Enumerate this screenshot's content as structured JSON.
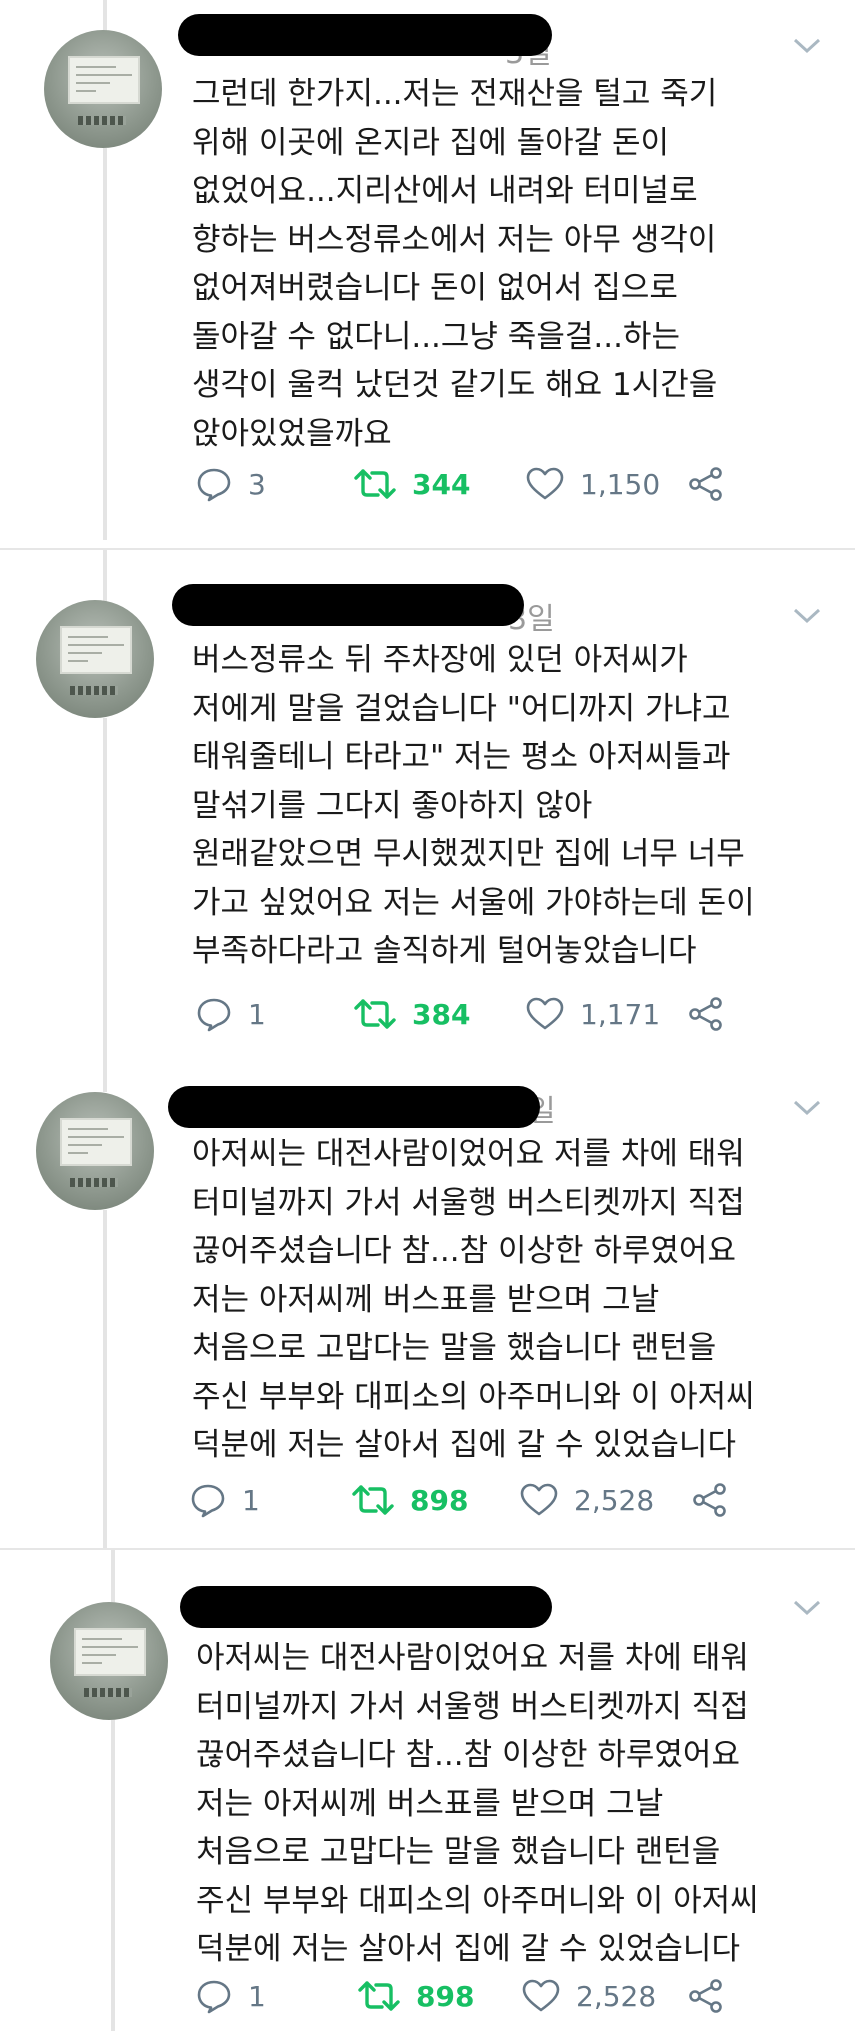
{
  "tweets": [
    {
      "date_fragment": "3일",
      "text": "그런데 한가지...저는 전재산을 털고 죽기\n위해 이곳에 온지라 집에 돌아갈 돈이\n없었어요...지리산에서 내려와 터미널로\n향하는 버스정류소에서 저는 아무 생각이\n없어져버렸습니다 돈이 없어서 집으로\n돌아갈 수 없다니...그냥 죽을걸...하는\n생각이 울컥 났던것 같기도 해요 1시간을\n앉아있었을까요",
      "replies": "3",
      "retweets": "344",
      "likes": "1,150"
    },
    {
      "date_fragment": "3일",
      "text": "버스정류소 뒤 주차장에 있던 아저씨가\n저에게 말을 걸었습니다 \"어디까지 가냐고\n태워줄테니 타라고\" 저는 평소 아저씨들과\n말섞기를 그다지 좋아하지 않아\n원래같았으면 무시했겠지만 집에 너무 너무\n가고 싶었어요 저는 서울에 가야하는데 돈이\n부족하다라고 솔직하게 털어놓았습니다",
      "replies": "1",
      "retweets": "384",
      "likes": "1,171"
    },
    {
      "date_fragment": "일",
      "text": "아저씨는 대전사람이었어요 저를 차에 태워\n터미널까지 가서 서울행 버스티켓까지 직접\n끊어주셨습니다 참...참 이상한 하루였어요\n저는 아저씨께 버스표를 받으며 그날\n처음으로 고맙다는 말을 했습니다 랜턴을\n주신 부부와 대피소의 아주머니와 이 아저씨\n덕분에 저는 살아서 집에 갈 수 있었습니다",
      "replies": "1",
      "retweets": "898",
      "likes": "2,528"
    },
    {
      "date_fragment": "",
      "text": "아저씨는 대전사람이었어요 저를 차에 태워\n터미널까지 가서 서울행 버스티켓까지 직접\n끊어주셨습니다 참...참 이상한 하루였어요\n저는 아저씨께 버스표를 받으며 그날\n처음으로 고맙다는 말을 했습니다 랜턴을\n주신 부부와 대피소의 아주머니와 이 아저씨\n덕분에 저는 살아서 집에 갈 수 있었습니다",
      "replies": "1",
      "retweets": "898",
      "likes": "2,528"
    }
  ],
  "icons": {
    "reply": "reply-icon",
    "retweet": "retweet-icon",
    "like": "heart-icon",
    "share": "share-icon",
    "menu": "chevron-down-icon"
  },
  "colors": {
    "retweet_active": "#17bf63",
    "action_gray": "#657786",
    "redaction": "#000000"
  }
}
